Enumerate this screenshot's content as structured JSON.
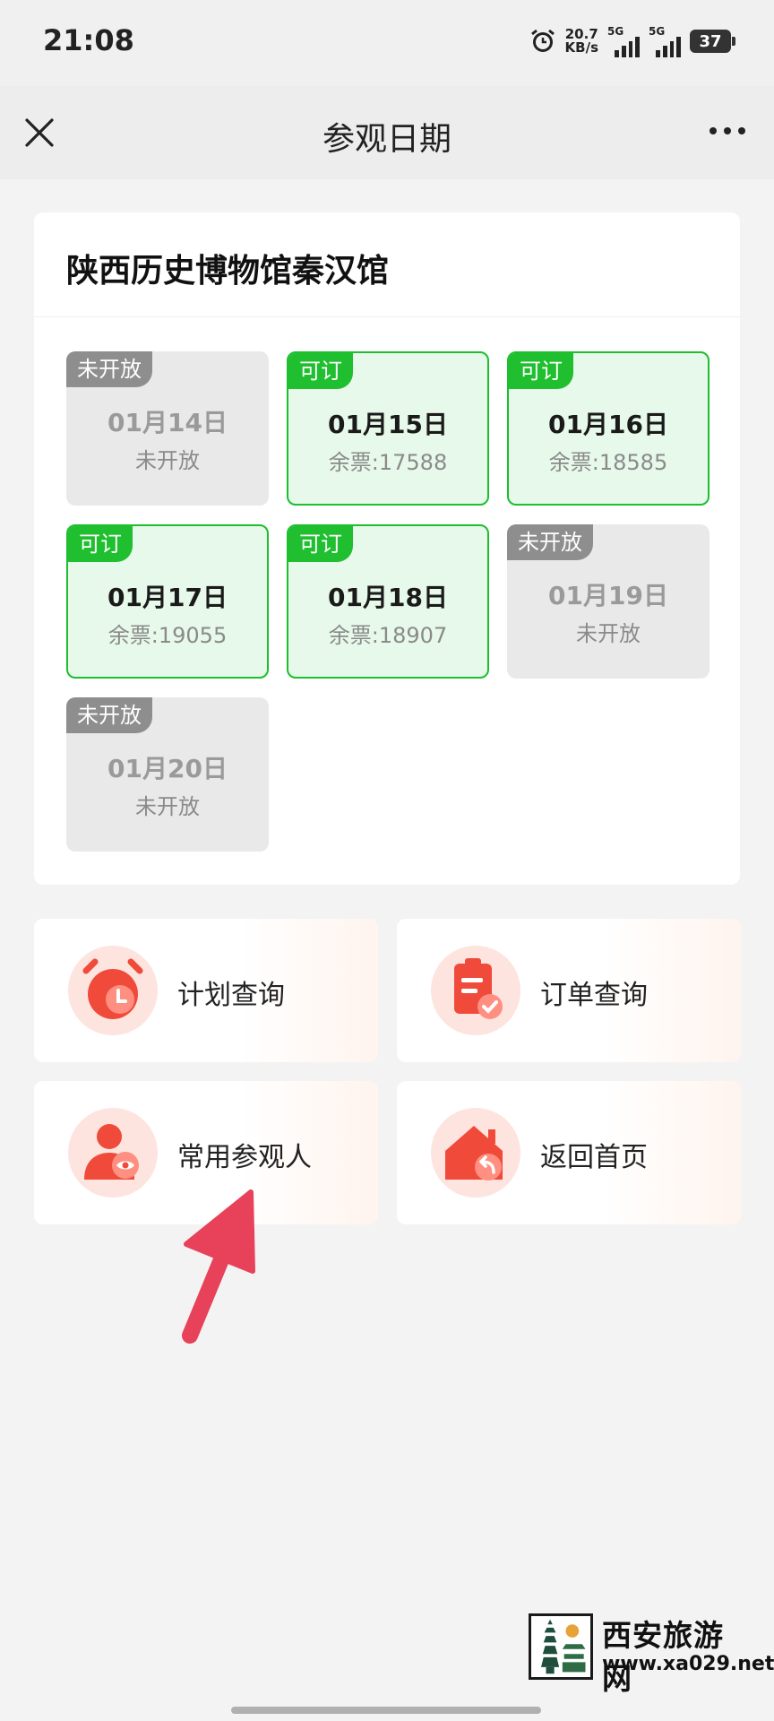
{
  "status_bar": {
    "time": "21:08",
    "net_speed_value": "20.7",
    "net_speed_unit": "KB/s",
    "signal1_label": "5G",
    "signal2_label": "5G",
    "battery": "37",
    "icons": [
      "alarm-icon",
      "signal-icon",
      "signal-icon",
      "battery-icon"
    ]
  },
  "nav": {
    "title": "参观日期",
    "close_icon": "close-icon",
    "more_icon": "more-icon"
  },
  "museum": {
    "name": "陕西历史博物馆秦汉馆",
    "dates": [
      {
        "badge": "未开放",
        "date": "01月14日",
        "sub": "未开放",
        "status": "closed"
      },
      {
        "badge": "可订",
        "date": "01月15日",
        "sub": "余票:17588",
        "status": "open"
      },
      {
        "badge": "可订",
        "date": "01月16日",
        "sub": "余票:18585",
        "status": "open"
      },
      {
        "badge": "可订",
        "date": "01月17日",
        "sub": "余票:19055",
        "status": "open"
      },
      {
        "badge": "可订",
        "date": "01月18日",
        "sub": "余票:18907",
        "status": "open"
      },
      {
        "badge": "未开放",
        "date": "01月19日",
        "sub": "未开放",
        "status": "closed"
      },
      {
        "badge": "未开放",
        "date": "01月20日",
        "sub": "未开放",
        "status": "closed"
      }
    ]
  },
  "actions": [
    {
      "label": "计划查询",
      "icon": "alarm-clock-icon"
    },
    {
      "label": "订单查询",
      "icon": "clipboard-check-icon"
    },
    {
      "label": "常用参观人",
      "icon": "user-eye-icon"
    },
    {
      "label": "返回首页",
      "icon": "home-return-icon"
    }
  ],
  "watermark": {
    "title": "西安旅游网",
    "url": "www.xa029.net"
  },
  "colors": {
    "open_green": "#1fbf2f",
    "open_bg": "#e7f9ea",
    "closed_bg": "#e9e9e9",
    "closed_badge": "#8e8e8e",
    "icon_red": "#f04a3a",
    "arrow": "#e8415a"
  }
}
